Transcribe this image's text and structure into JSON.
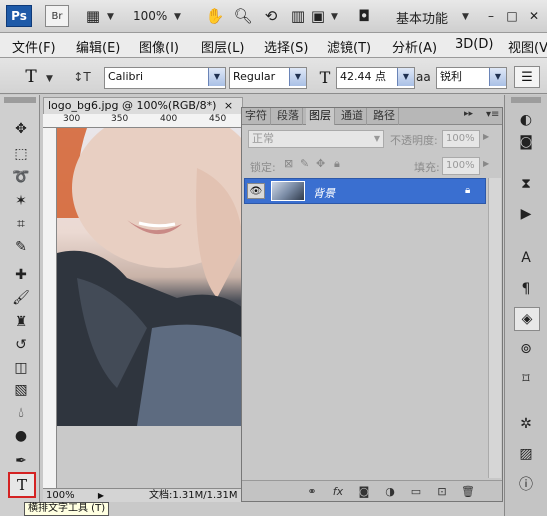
{
  "appbar": {
    "logo": "Ps",
    "bridge": "Br",
    "zoom": "100%",
    "workspace": "基本功能",
    "minimize": "–",
    "maximize": "□",
    "close": "✕"
  },
  "menu": [
    "文件(F)",
    "编辑(E)",
    "图像(I)",
    "图层(L)",
    "选择(S)",
    "滤镜(T)",
    "分析(A)",
    "3D(D)",
    "视图(V)"
  ],
  "options": {
    "tool_glyph": "T",
    "font_family": "Calibri",
    "font_style": "Regular",
    "font_size": "42.44 点",
    "aa_label": "aa",
    "anti_alias": "锐利"
  },
  "document": {
    "tab_title": "logo_bg6.jpg @ 100%(RGB/8*)",
    "tab_close": "×",
    "ruler_marks": [
      "300",
      "350",
      "400",
      "450"
    ],
    "zoom_status": "100%",
    "doc_info": "文档:1.31M/1.31M"
  },
  "layers_panel": {
    "tabs": [
      "字符",
      "段落",
      "图层",
      "通道",
      "路径"
    ],
    "active_tab": "图层",
    "blend_mode": "正常",
    "opacity_label": "不透明度:",
    "opacity_value": "100%",
    "lock_label": "锁定:",
    "fill_label": "填充:",
    "fill_value": "100%",
    "layer_name": "背景"
  },
  "tooltip": "横排文字工具 (T)",
  "colors": {
    "accent": "#3a6fd0",
    "highlight_box": "#d42222",
    "ps_blue": "#1e5aa8"
  }
}
